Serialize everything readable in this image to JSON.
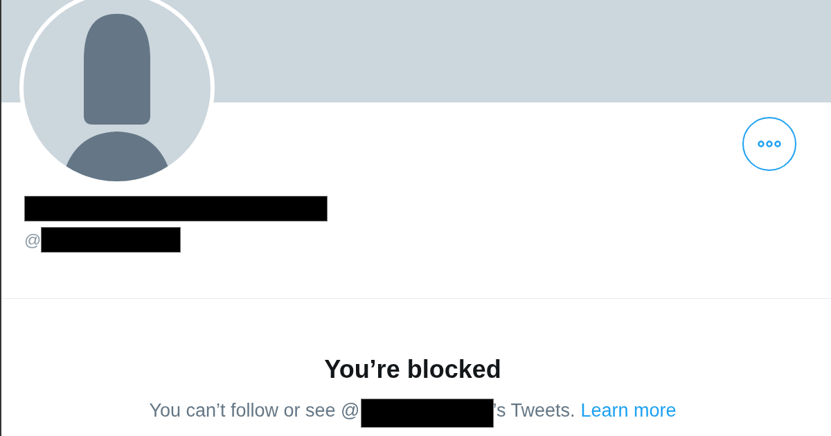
{
  "profile": {
    "handle_prefix": "@"
  },
  "blocked_notice": {
    "title": "You’re blocked",
    "message_start": "You can’t follow or see @",
    "message_end": "’s Tweets.",
    "link": "Learn more"
  }
}
